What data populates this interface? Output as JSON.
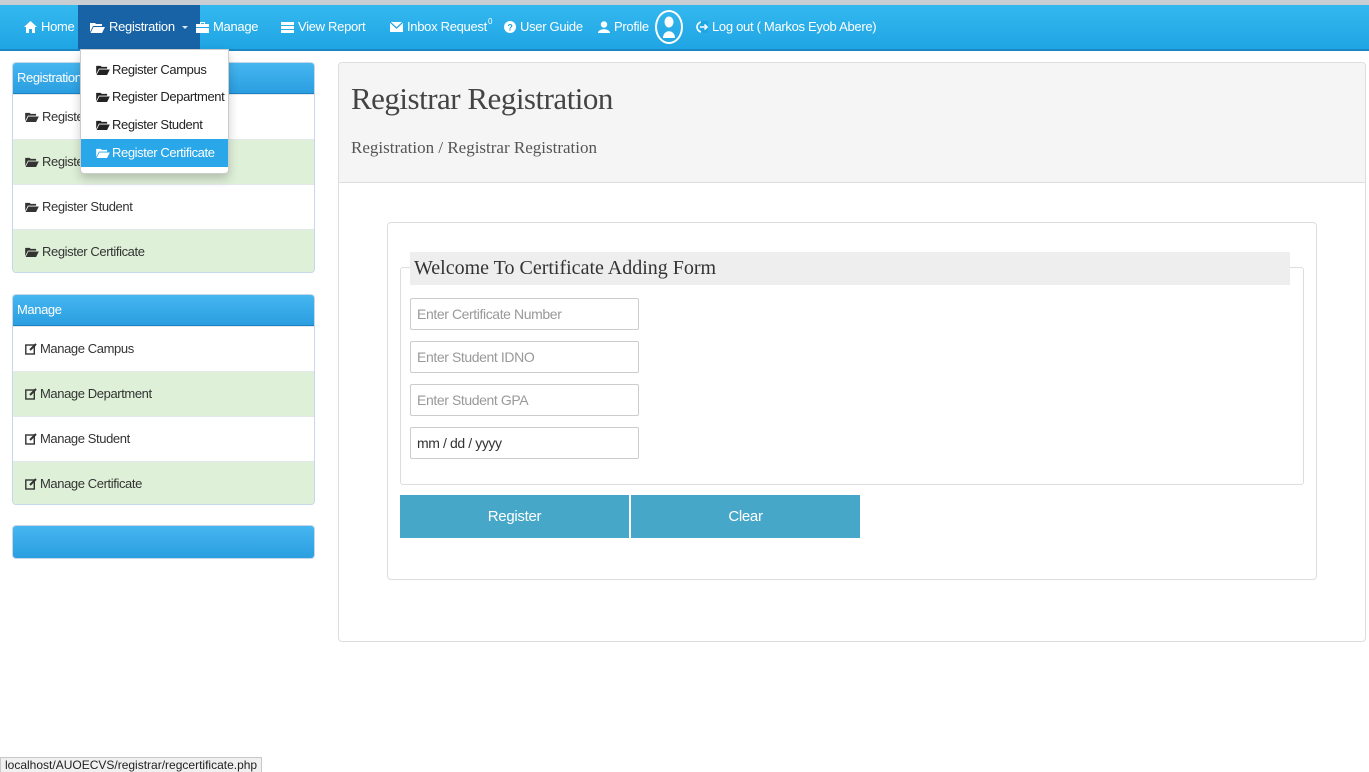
{
  "nav": {
    "home": "Home",
    "registration": "Registration",
    "manage": "Manage",
    "view_report": "View Report",
    "inbox": "Inbox Request",
    "inbox_count": "0",
    "user_guide": "User Guide",
    "profile": "Profile",
    "logout": "Log out ( Markos Eyob Abere)"
  },
  "dropdown": {
    "items": [
      "Register Campus",
      "Register Department",
      "Register Student",
      "Register Certificate"
    ],
    "highlighted": "Register Certificate"
  },
  "sidebar": {
    "registration_title": "Registration",
    "registration_items": [
      "Register",
      "Register",
      "Register Student",
      "Register Certificate"
    ],
    "manage_title": "Manage",
    "manage_items": [
      "Manage Campus",
      "Manage Department",
      "Manage Student",
      "Manage Certificate"
    ],
    "third_title": ""
  },
  "main": {
    "title": "Registrar Registration",
    "breadcrumb": "Registration / Registrar Registration",
    "legend": "Welcome To Certificate Adding Form",
    "fields": {
      "certificate_number": "Enter Certificate Number",
      "student_idno": "Enter Student IDNO",
      "student_gpa": "Enter Student GPA",
      "date": "mm / dd / yyyy"
    },
    "register_button": "Register",
    "clear_button": "Clear"
  },
  "status_url": "localhost/AUOECVS/registrar/regcertificate.php",
  "colors": {
    "navbar": "#1fa5e3",
    "nav_active": "#1763a6",
    "highlight": "#29a7e8",
    "alt_row": "#dff0d8",
    "button": "#46a7c9"
  }
}
